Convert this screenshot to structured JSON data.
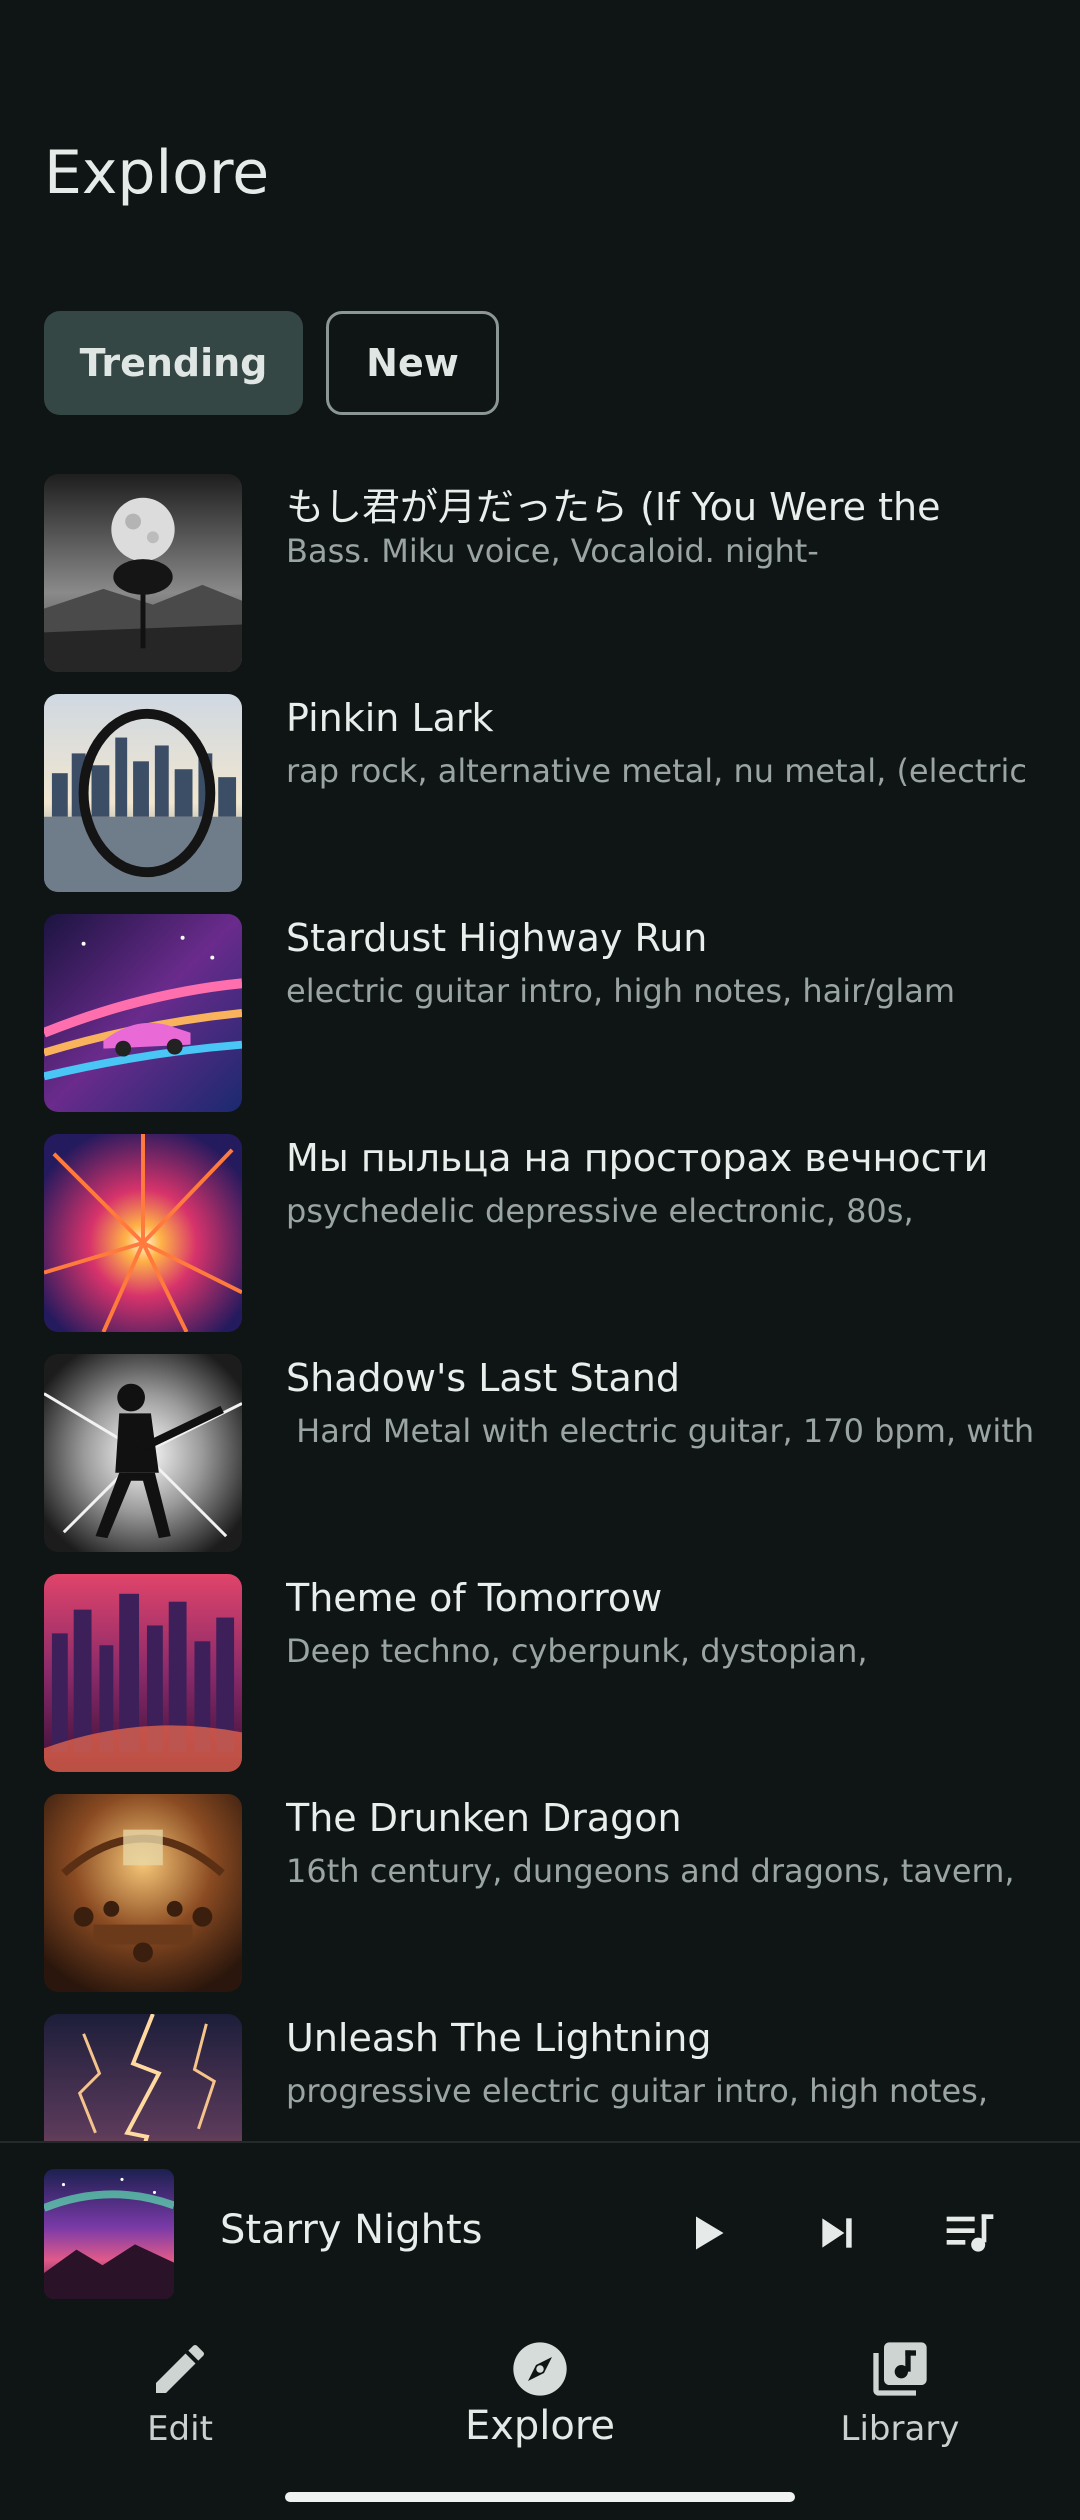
{
  "header": {
    "title": "Explore"
  },
  "tabs": [
    {
      "label": "Trending",
      "selected": true
    },
    {
      "label": "New",
      "selected": false
    }
  ],
  "songs": [
    {
      "title": "もし君が月だったら (If You Were the",
      "description": "Bass. Miku voice, Vocaloid. night-",
      "art": "moon-tree-art"
    },
    {
      "title": "Pinkin Lark",
      "description": "rap rock, alternative metal, nu metal, (electric",
      "art": "city-ring-art"
    },
    {
      "title": "Stardust Highway Run",
      "description": "electric guitar intro, high notes, hair/glam",
      "art": "neon-car-art"
    },
    {
      "title": "Мы пыльца на просторах вечности",
      "description": "psychedelic depressive electronic, 80s,",
      "art": "cosmic-burst-art"
    },
    {
      "title": "Shadow's Last Stand",
      "description": " Hard Metal with electric guitar, 170 bpm, with",
      "art": "guitarist-art"
    },
    {
      "title": "Theme of Tomorrow",
      "description": "Deep techno, cyberpunk, dystopian,",
      "art": "cyber-city-art"
    },
    {
      "title": "The Drunken Dragon",
      "description": "16th century, dungeons and dragons, tavern,",
      "art": "tavern-art"
    },
    {
      "title": "Unleash The Lightning",
      "description": "progressive electric guitar intro, high notes,",
      "art": "lightning-art"
    }
  ],
  "mini_player": {
    "title": "Starry Nights",
    "art": "aurora-art"
  },
  "nav": [
    {
      "label": "Edit",
      "icon": "pencil-icon",
      "active": false
    },
    {
      "label": "Explore",
      "icon": "compass-icon",
      "active": true
    },
    {
      "label": "Library",
      "icon": "library-music-icon",
      "active": false
    }
  ],
  "colors": {
    "background": "#0f1414",
    "chip_selected": "#344744",
    "text_primary": "#e8eeec",
    "text_secondary": "#9aa4a2"
  }
}
